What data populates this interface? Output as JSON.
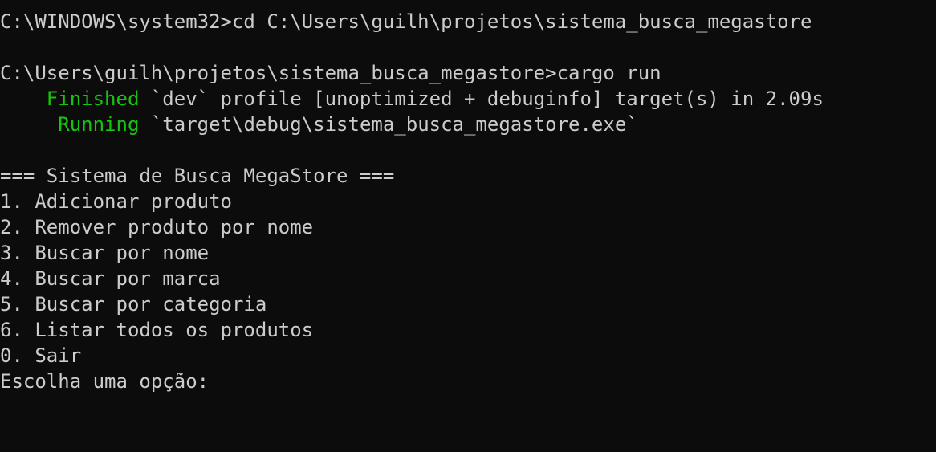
{
  "terminal": {
    "prompt1": "C:\\WINDOWS\\system32>",
    "command1": "cd C:\\Users\\guilh\\projetos\\sistema_busca_megastore",
    "prompt2": "C:\\Users\\guilh\\projetos\\sistema_busca_megastore>",
    "command2": "cargo run",
    "finished_indent": "    ",
    "finished_label": "Finished",
    "finished_text": " `dev` profile [unoptimized + debuginfo] target(s) in 2.09s",
    "running_indent": "     ",
    "running_label": "Running",
    "running_text": " `target\\debug\\sistema_busca_megastore.exe`",
    "colors": {
      "background": "#0c0c0c",
      "foreground": "#cccccc",
      "cargo_status_green": "#16c60c"
    }
  },
  "menu": {
    "title": "=== Sistema de Busca MegaStore ===",
    "options": [
      "1. Adicionar produto",
      "2. Remover produto por nome",
      "3. Buscar por nome",
      "4. Buscar por marca",
      "5. Buscar por categoria",
      "6. Listar todos os produtos",
      "0. Sair"
    ],
    "input_prompt": "Escolha uma opção:"
  }
}
